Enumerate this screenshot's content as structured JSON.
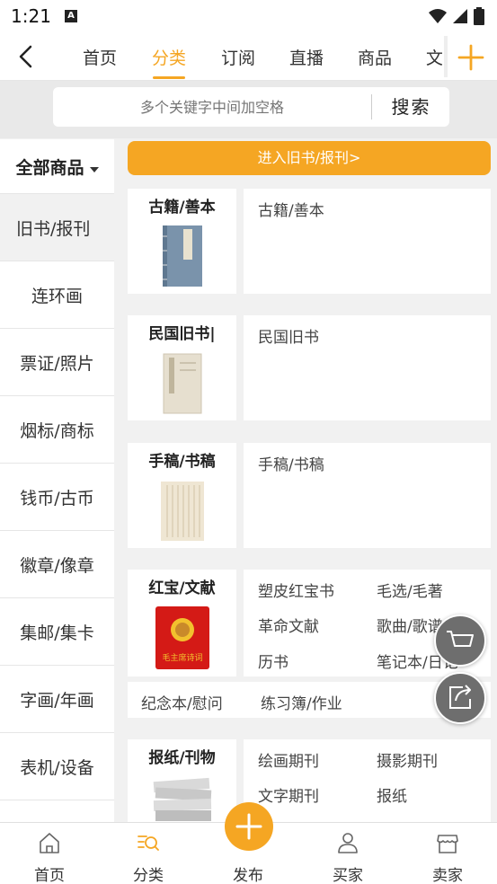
{
  "status": {
    "time": "1:21",
    "notif": "A"
  },
  "nav": {
    "tabs": [
      "首页",
      "分类",
      "订阅",
      "直播",
      "商品",
      "文"
    ],
    "active_tab": "分类"
  },
  "search": {
    "placeholder": "多个关键字中间加空格",
    "button": "搜索"
  },
  "sidebar": {
    "header": "全部商品",
    "items": [
      "旧书/报刊",
      "连环画",
      "票证/照片",
      "烟标/商标",
      "钱币/古币",
      "徽章/像章",
      "集邮/集卡",
      "字画/年画",
      "表机/设备"
    ],
    "active": "旧书/报刊"
  },
  "content": {
    "enter_label": "进入旧书/报刊>",
    "cards": [
      {
        "title": "古籍/善本",
        "subs": [
          "古籍/善本"
        ]
      },
      {
        "title": "民国旧书|",
        "subs": [
          "民国旧书"
        ]
      },
      {
        "title": "手稿/书稿",
        "subs": [
          "手稿/书稿"
        ]
      },
      {
        "title": "红宝/文献",
        "subs": [
          "塑皮红宝书",
          "毛选/毛著",
          "革命文献",
          "歌曲/歌谱",
          "历书",
          "笔记本/日记",
          "纪念本/慰问",
          "练习簿/作业"
        ]
      },
      {
        "title": "报纸/刊物",
        "subs": [
          "绘画期刊",
          "摄影期刊",
          "文字期刊",
          "报纸"
        ]
      }
    ],
    "red_book_text": "毛主席诗词"
  },
  "bottom_nav": {
    "items": [
      "首页",
      "分类",
      "发布",
      "买家",
      "卖家"
    ],
    "active": "分类"
  },
  "colors": {
    "accent": "#f5a623"
  }
}
